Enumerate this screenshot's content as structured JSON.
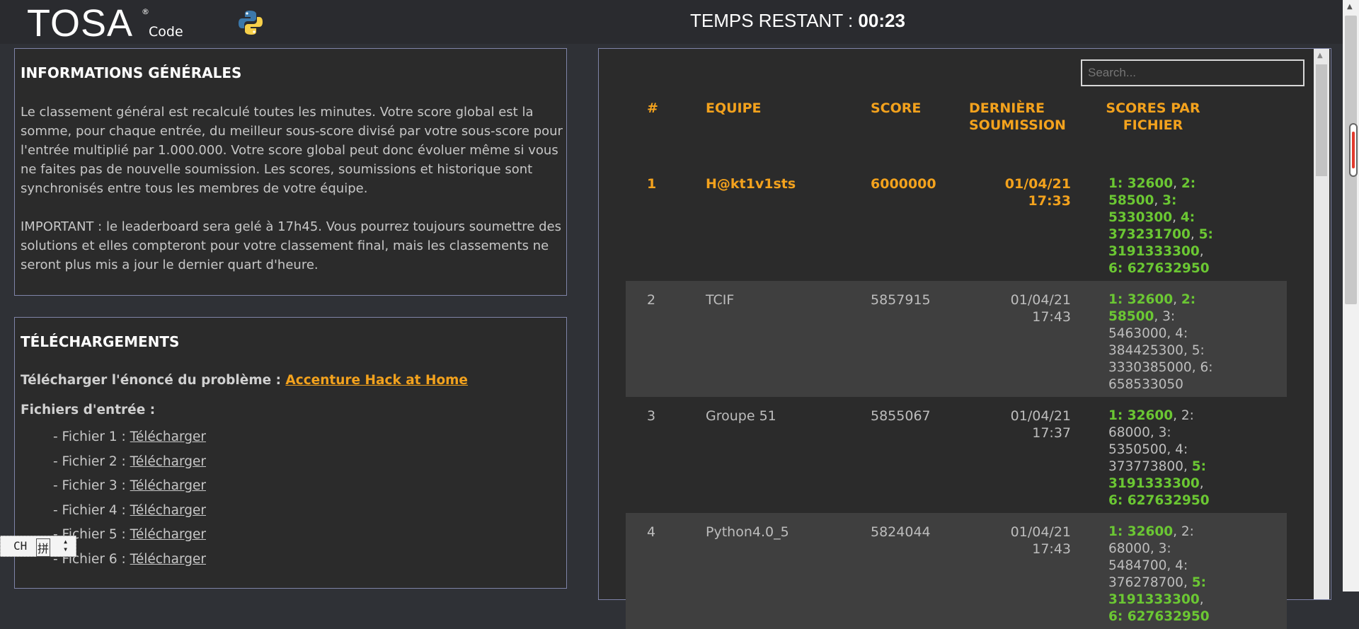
{
  "header": {
    "logo_text": "TOSA",
    "logo_reg": "®",
    "logo_sub": "Code",
    "timer_label": "TEMPS RESTANT : ",
    "timer_value": "00:23"
  },
  "info": {
    "title": "INFORMATIONS GÉNÉRALES",
    "paragraph1": "Le classement général est recalculé toutes les minutes. Votre score global est la somme, pour chaque entrée, du meilleur sous-score divisé par votre sous-score pour l'entrée multiplié par 1.000.000. Votre score global peut donc évoluer même si vous ne faites pas de nouvelle soumission. Les scores, soumissions et historique sont synchronisés entre tous les membres de votre équipe.",
    "paragraph2": "IMPORTANT : le leaderboard sera gelé à 17h45. Vous pourrez toujours soumettre des solutions et elles compteront pour votre classement final, mais les classements ne seront plus mis a jour le dernier quart d'heure."
  },
  "downloads": {
    "title": "TÉLÉCHARGEMENTS",
    "statement_label": "Télécharger l'énoncé du problème : ",
    "statement_link": "Accenture Hack at Home",
    "inputs_label": "Fichiers d'entrée :",
    "files": [
      {
        "label": "- Fichier 1 : ",
        "link": "Télécharger"
      },
      {
        "label": "- Fichier 2 : ",
        "link": "Télécharger"
      },
      {
        "label": "- Fichier 3 : ",
        "link": "Télécharger"
      },
      {
        "label": "- Fichier 4 : ",
        "link": "Télécharger"
      },
      {
        "label": "- Fichier 5 : ",
        "link": "Télécharger"
      },
      {
        "label": "- Fichier 6 : ",
        "link": "Télécharger"
      }
    ]
  },
  "leaderboard": {
    "search_placeholder": "Search...",
    "headers": {
      "rank": "#",
      "team": "EQUIPE",
      "score": "SCORE",
      "last_submission_1": "DERNIÈRE",
      "last_submission_2": "SOUMISSION",
      "file_scores_1": "SCORES PAR",
      "file_scores_2": "FICHIER"
    },
    "rows": [
      {
        "rank": "1",
        "team": "H@kt1v1sts",
        "score": "6000000",
        "date": "01/04/21",
        "time": "17:33",
        "scores": [
          {
            "text": "1: 32600",
            "best": true
          },
          {
            "text": "2: 58500",
            "best": true
          },
          {
            "text": "3: 5330300",
            "best": true
          },
          {
            "text": "4: 373231700",
            "best": true
          },
          {
            "text": "5: 3191333300",
            "best": true
          },
          {
            "text": "6: 627632950",
            "best": true
          }
        ]
      },
      {
        "rank": "2",
        "team": "TCIF",
        "score": "5857915",
        "date": "01/04/21",
        "time": "17:43",
        "scores": [
          {
            "text": "1: 32600",
            "best": true
          },
          {
            "text": "2: 58500",
            "best": true
          },
          {
            "text": "3: 5463000",
            "best": false
          },
          {
            "text": "4: 384425300",
            "best": false
          },
          {
            "text": "5: 3330385000",
            "best": false
          },
          {
            "text": "6: 658533050",
            "best": false
          }
        ]
      },
      {
        "rank": "3",
        "team": "Groupe 51",
        "score": "5855067",
        "date": "01/04/21",
        "time": "17:37",
        "scores": [
          {
            "text": "1: 32600",
            "best": true
          },
          {
            "text": "2: 68000",
            "best": false
          },
          {
            "text": "3: 5350500",
            "best": false
          },
          {
            "text": "4: 373773800",
            "best": false
          },
          {
            "text": "5: 3191333300",
            "best": true
          },
          {
            "text": "6: 627632950",
            "best": true
          }
        ]
      },
      {
        "rank": "4",
        "team": "Python4.0_5",
        "score": "5824044",
        "date": "01/04/21",
        "time": "17:43",
        "scores": [
          {
            "text": "1: 32600",
            "best": true
          },
          {
            "text": "2: 68000",
            "best": false
          },
          {
            "text": "3: 5484700",
            "best": false
          },
          {
            "text": "4: 376278700",
            "best": false
          },
          {
            "text": "5: 3191333300",
            "best": true
          },
          {
            "text": "6: 627632950",
            "best": true
          }
        ]
      }
    ]
  },
  "ime": {
    "mode": "CH",
    "layout_icon": "拼"
  },
  "colors": {
    "accent": "#f3a21d",
    "best_score": "#6bc733",
    "panel_border": "#7f84a8"
  }
}
